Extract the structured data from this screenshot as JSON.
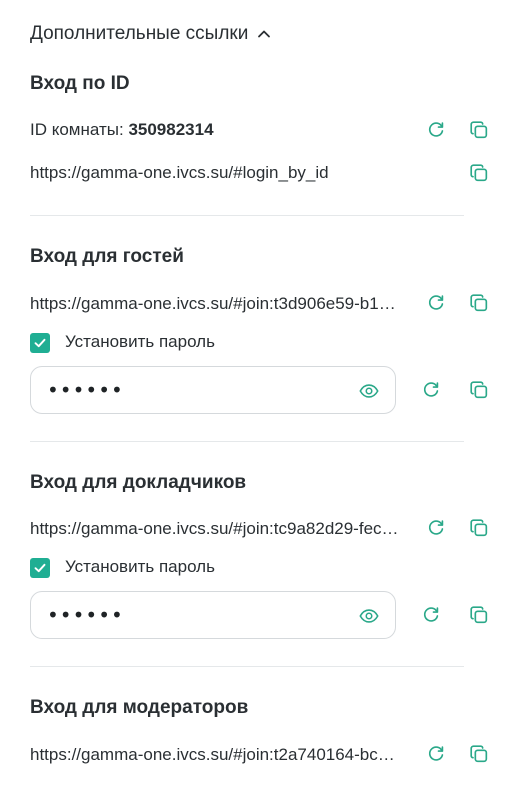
{
  "header": {
    "title": "Дополнительные ссылки"
  },
  "login_by_id": {
    "title": "Вход по ID",
    "room_id_label": "ID комнаты:",
    "room_id_value": "350982314",
    "url": "https://gamma-one.ivcs.su/#login_by_id"
  },
  "guests": {
    "title": "Вход для гостей",
    "url": "https://gamma-one.ivcs.su/#join:t3d906e59-b1…",
    "set_password_label": "Установить пароль",
    "password_mask": "••••••"
  },
  "speakers": {
    "title": "Вход для докладчиков",
    "url": "https://gamma-one.ivcs.su/#join:tc9a82d29-fec…",
    "set_password_label": "Установить пароль",
    "password_mask": "••••••"
  },
  "moderators": {
    "title": "Вход для модераторов",
    "url": "https://gamma-one.ivcs.su/#join:t2a740164-bc…"
  },
  "colors": {
    "accent": "#1fae93",
    "icon": "#2aa889",
    "text": "#2a2f33",
    "divider": "#e5e8ea"
  },
  "icons": {
    "refresh": "refresh-icon",
    "copy": "copy-icon",
    "eye": "eye-icon",
    "chevron": "chevron-up-icon"
  }
}
